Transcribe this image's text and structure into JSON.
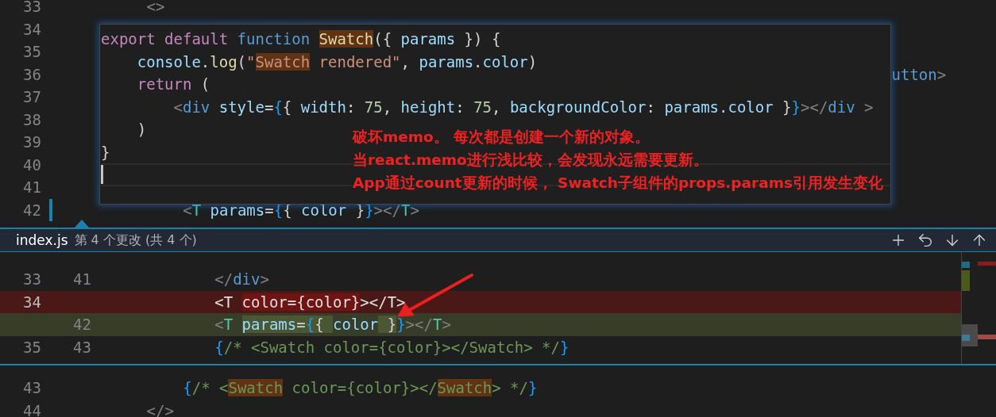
{
  "editor": {
    "lines": [
      {
        "number": "33",
        "modified": false,
        "code": [
          {
            "kind": "tagpunct",
            "text": "        <>",
            "highlight": false
          }
        ]
      },
      {
        "number": "34",
        "modified": false
      },
      {
        "number": "35",
        "modified": false
      },
      {
        "number": "36",
        "modified": false,
        "code": [
          {
            "kind": "tag",
            "text": "                                                                                          utton",
            "highlight": false
          },
          {
            "kind": "tagpunct",
            "text": ">",
            "highlight": false
          }
        ]
      },
      {
        "number": "37",
        "modified": false
      },
      {
        "number": "38",
        "modified": false
      },
      {
        "number": "39",
        "modified": false
      },
      {
        "number": "40",
        "modified": false
      },
      {
        "number": "41",
        "modified": false
      },
      {
        "number": "42",
        "modified": true,
        "code": [
          {
            "kind": "tagpunct",
            "text": "            <",
            "highlight": false
          },
          {
            "kind": "component",
            "text": "T",
            "highlight": false
          },
          {
            "kind": "variable",
            "text": " params",
            "highlight": false
          },
          {
            "kind": "punct",
            "text": "=",
            "highlight": false
          },
          {
            "kind": "brace",
            "text": "{",
            "highlight": false
          },
          {
            "kind": "punct",
            "text": "{ ",
            "highlight": false
          },
          {
            "kind": "variable",
            "text": "color",
            "highlight": false
          },
          {
            "kind": "punct",
            "text": " }",
            "highlight": false
          },
          {
            "kind": "brace",
            "text": "}",
            "highlight": false
          },
          {
            "kind": "tagpunct",
            "text": "></",
            "highlight": false
          },
          {
            "kind": "component",
            "text": "T",
            "highlight": false
          },
          {
            "kind": "tagpunct",
            "text": ">",
            "highlight": false
          }
        ]
      }
    ]
  },
  "hover": {
    "lines": [
      [
        {
          "kind": "keyword",
          "text": "export default ",
          "highlight": false
        },
        {
          "kind": "storage",
          "text": "function ",
          "highlight": false
        },
        {
          "kind": "function",
          "text": "Swatch",
          "highlight": true
        },
        {
          "kind": "punct",
          "text": "({ ",
          "highlight": false
        },
        {
          "kind": "variable",
          "text": "params",
          "highlight": false
        },
        {
          "kind": "punct",
          "text": " }) {",
          "highlight": false
        }
      ],
      [
        {
          "kind": "variable",
          "text": "    console",
          "highlight": false
        },
        {
          "kind": "punct",
          "text": ".",
          "highlight": false
        },
        {
          "kind": "function",
          "text": "log",
          "highlight": false
        },
        {
          "kind": "punct",
          "text": "(",
          "highlight": false
        },
        {
          "kind": "string",
          "text": "\"",
          "highlight": false
        },
        {
          "kind": "string",
          "text": "Swatch",
          "highlight": true
        },
        {
          "kind": "string",
          "text": " rendered\"",
          "highlight": false
        },
        {
          "kind": "punct",
          "text": ", ",
          "highlight": false
        },
        {
          "kind": "variable",
          "text": "params",
          "highlight": false
        },
        {
          "kind": "punct",
          "text": ".",
          "highlight": false
        },
        {
          "kind": "variable",
          "text": "color",
          "highlight": false
        },
        {
          "kind": "punct",
          "text": ")",
          "highlight": false
        }
      ],
      [
        {
          "kind": "keyword",
          "text": "    return",
          "highlight": false
        },
        {
          "kind": "punct",
          "text": " (",
          "highlight": false
        }
      ],
      [
        {
          "kind": "tagpunct",
          "text": "        <",
          "highlight": false
        },
        {
          "kind": "tag",
          "text": "div",
          "highlight": false
        },
        {
          "kind": "variable",
          "text": " style",
          "highlight": false
        },
        {
          "kind": "punct",
          "text": "=",
          "highlight": false
        },
        {
          "kind": "brace",
          "text": "{",
          "highlight": false
        },
        {
          "kind": "punct",
          "text": "{ ",
          "highlight": false
        },
        {
          "kind": "variable",
          "text": "width",
          "highlight": false
        },
        {
          "kind": "punct",
          "text": ": ",
          "highlight": false
        },
        {
          "kind": "number",
          "text": "75",
          "highlight": false
        },
        {
          "kind": "punct",
          "text": ", ",
          "highlight": false
        },
        {
          "kind": "variable",
          "text": "height",
          "highlight": false
        },
        {
          "kind": "punct",
          "text": ": ",
          "highlight": false
        },
        {
          "kind": "number",
          "text": "75",
          "highlight": false
        },
        {
          "kind": "punct",
          "text": ", ",
          "highlight": false
        },
        {
          "kind": "variable",
          "text": "backgroundColor",
          "highlight": false
        },
        {
          "kind": "punct",
          "text": ": ",
          "highlight": false
        },
        {
          "kind": "variable",
          "text": "params.color",
          "highlight": false
        },
        {
          "kind": "punct",
          "text": " }",
          "highlight": false
        },
        {
          "kind": "brace",
          "text": "}",
          "highlight": false
        },
        {
          "kind": "tagpunct",
          "text": "></",
          "highlight": false
        },
        {
          "kind": "tag",
          "text": "div",
          "highlight": false
        },
        {
          "kind": "tagpunct",
          "text": " >",
          "highlight": false
        }
      ],
      [
        {
          "kind": "punct",
          "text": "    )",
          "highlight": false
        }
      ],
      [
        {
          "kind": "punct",
          "text": "}",
          "highlight": false
        }
      ]
    ],
    "annotation": [
      "破坏memo。 每次都是创建一个新的对象。",
      "当react.memo进行浅比较，会发现永远需要更新。",
      "App通过count更新的时候， Swatch子组件的props.params引用发生变化"
    ]
  },
  "peek": {
    "file": "index.js",
    "change": "第 4 个更改 (共 4 个)",
    "rows": [
      {
        "kind": "context",
        "old": "33",
        "new": "41",
        "code": [
          {
            "kind": "tagpunct",
            "text": "            </",
            "highlight": false
          },
          {
            "kind": "tag",
            "text": "div",
            "highlight": false
          },
          {
            "kind": "tagpunct",
            "text": ">",
            "highlight": false
          }
        ]
      },
      {
        "kind": "removed",
        "old": "34",
        "code": [
          {
            "kind": "plain",
            "text": "            <T ",
            "highlight": false
          },
          {
            "kind": "plain",
            "text": "color={color}",
            "highlight": true
          },
          {
            "kind": "plain",
            "text": "></T>",
            "highlight": false
          }
        ]
      },
      {
        "kind": "added",
        "new": "42",
        "code": [
          {
            "kind": "tagpunct",
            "text": "            <",
            "highlight": false
          },
          {
            "kind": "component",
            "text": "T ",
            "highlight": false
          },
          {
            "kind": "variable",
            "text": "params",
            "highlight": true
          },
          {
            "kind": "punct",
            "text": "=",
            "highlight": true
          },
          {
            "kind": "brace",
            "text": "{",
            "highlight": true
          },
          {
            "kind": "punct",
            "text": "{ ",
            "highlight": true
          },
          {
            "kind": "variable",
            "text": "color",
            "highlight": false
          },
          {
            "kind": "punct",
            "text": " }",
            "highlight": true
          },
          {
            "kind": "brace",
            "text": "}",
            "highlight": false
          },
          {
            "kind": "tagpunct",
            "text": "></",
            "highlight": false
          },
          {
            "kind": "component",
            "text": "T",
            "highlight": false
          },
          {
            "kind": "tagpunct",
            "text": ">",
            "highlight": false
          }
        ]
      },
      {
        "kind": "context",
        "old": "35",
        "new": "43",
        "code": [
          {
            "kind": "brace",
            "text": "            {",
            "highlight": false
          },
          {
            "kind": "comment",
            "text": "/* <Swatch color={color}></Swatch> */",
            "highlight": false
          },
          {
            "kind": "brace",
            "text": "}",
            "highlight": false
          }
        ]
      }
    ]
  },
  "lower_editor": {
    "lines": [
      {
        "number": "43",
        "code": [
          {
            "kind": "brace",
            "text": "            {",
            "highlight": false
          },
          {
            "kind": "comment",
            "text": "/* <",
            "highlight": false
          },
          {
            "kind": "comment",
            "text": "Swatch",
            "highlight": true
          },
          {
            "kind": "comment",
            "text": " color={color}></",
            "highlight": false
          },
          {
            "kind": "comment",
            "text": "Swatch",
            "highlight": true
          },
          {
            "kind": "comment",
            "text": "> */",
            "highlight": false
          },
          {
            "kind": "brace",
            "text": "}",
            "highlight": false
          }
        ]
      },
      {
        "number": "44",
        "code": [
          {
            "kind": "tagpunct",
            "text": "        </>",
            "highlight": false
          }
        ]
      }
    ]
  }
}
